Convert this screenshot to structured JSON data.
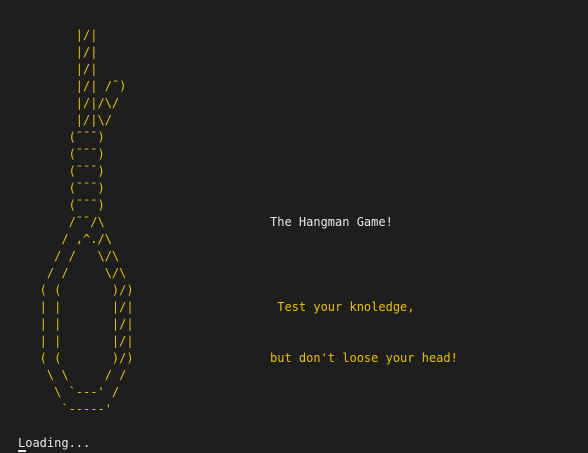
{
  "terminal": {
    "colors": {
      "background": "#1e1e1e",
      "art": "#e6c200",
      "text": "#e8e8e8",
      "tagline": "#e6c200"
    },
    "art_lines": [
      "        |/|",
      "        |/|",
      "        |/|",
      "        |/| /¯)",
      "        |/|/\\/",
      "        |/|\\/",
      "       (¯¯¯)",
      "       (¯¯¯)",
      "       (¯¯¯)",
      "       (¯¯¯)",
      "       (¯¯¯)",
      "       /¯¯/\\",
      "      / ,^./\\",
      "     / /   \\/\\",
      "    / /     \\/\\",
      "   ( (       )/)",
      "   | |       |/|",
      "   | |       |/|",
      "   | |       |/|",
      "   ( (       )/)",
      "    \\ \\     / /",
      "     \\ `---' /",
      "      `-----'"
    ],
    "title": "The Hangman Game!",
    "tagline_line1": " Test your knoledge,",
    "tagline_line2": "but don't loose your head!",
    "status": "Loading..."
  }
}
